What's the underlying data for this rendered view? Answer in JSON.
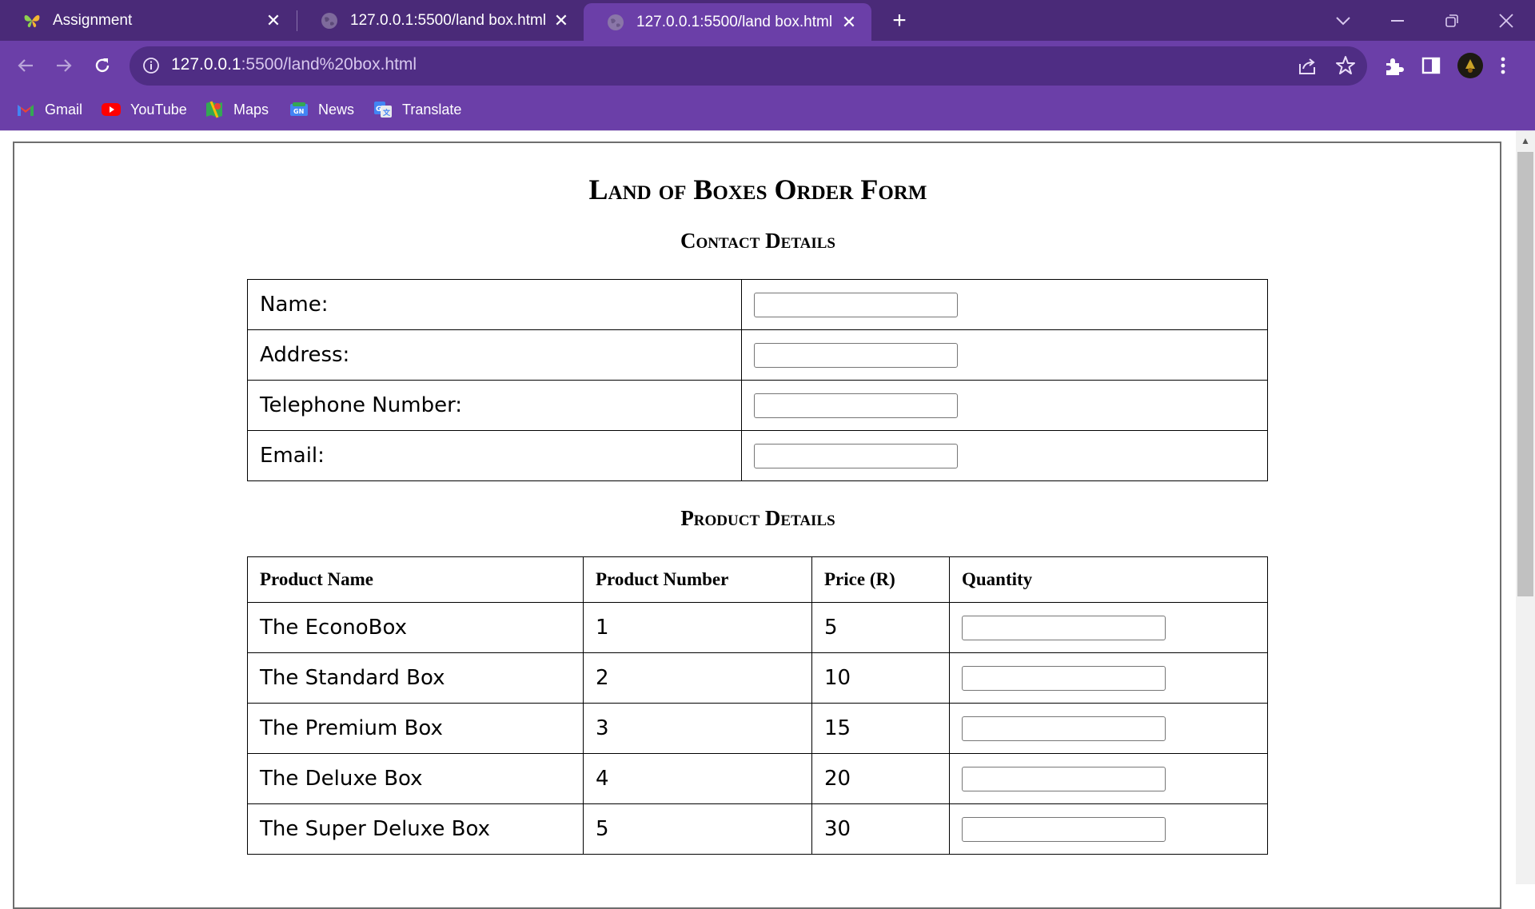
{
  "tabs": [
    {
      "title": "Assignment",
      "icon": "butterfly-icon"
    },
    {
      "title": "127.0.0.1:5500/land box.html",
      "icon": "globe-icon"
    },
    {
      "title": "127.0.0.1:5500/land box.html",
      "icon": "globe-icon",
      "active": true
    }
  ],
  "address_bar": {
    "host": "127.0.0.1",
    "path": ":5500/land%20box.html"
  },
  "bookmarks": [
    {
      "label": "Gmail",
      "icon": "gmail-icon"
    },
    {
      "label": "YouTube",
      "icon": "youtube-icon"
    },
    {
      "label": "Maps",
      "icon": "maps-icon"
    },
    {
      "label": "News",
      "icon": "news-icon"
    },
    {
      "label": "Translate",
      "icon": "translate-icon"
    }
  ],
  "page": {
    "title": "Land of Boxes Order Form",
    "contact_heading": "Contact Details",
    "contact_fields": [
      {
        "label": "Name:"
      },
      {
        "label": "Address:"
      },
      {
        "label": "Telephone Number:"
      },
      {
        "label": "Email:"
      }
    ],
    "product_heading": "Product Details",
    "product_columns": [
      "Product Name",
      "Product Number",
      "Price (R)",
      "Quantity"
    ],
    "products": [
      {
        "name": "The EconoBox",
        "number": "1",
        "price": "5"
      },
      {
        "name": "The Standard Box",
        "number": "2",
        "price": "10"
      },
      {
        "name": "The Premium Box",
        "number": "3",
        "price": "15"
      },
      {
        "name": "The Deluxe Box",
        "number": "4",
        "price": "20"
      },
      {
        "name": "The Super Deluxe Box",
        "number": "5",
        "price": "30"
      }
    ]
  },
  "colors": {
    "tabbar": "#4a2a78",
    "toolbar": "#6b3fa8",
    "omnibox": "#4f2d84"
  }
}
